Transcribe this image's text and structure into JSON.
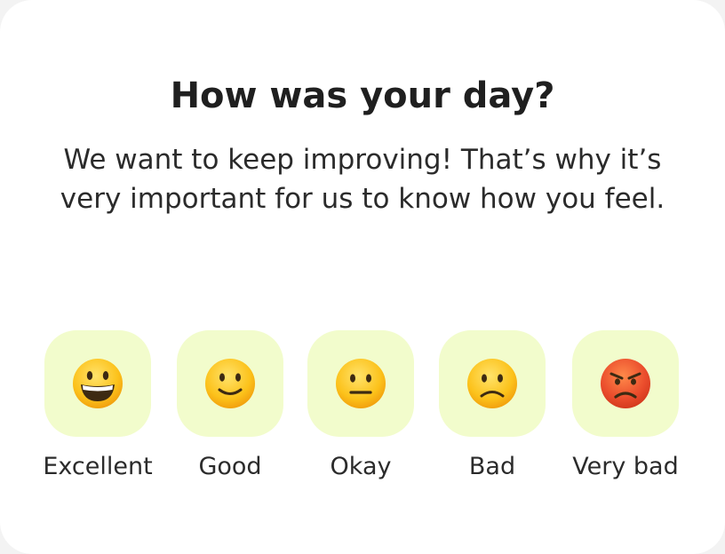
{
  "header": {
    "title": "How was your day?",
    "subtitle": "We want to keep improving! That’s why it’s very important for us to know how you feel."
  },
  "ratings": [
    {
      "label": "Excellent",
      "icon": "grinning-face-icon"
    },
    {
      "label": "Good",
      "icon": "slightly-smiling-face-icon"
    },
    {
      "label": "Okay",
      "icon": "neutral-face-icon"
    },
    {
      "label": "Bad",
      "icon": "slightly-frowning-face-icon"
    },
    {
      "label": "Very bad",
      "icon": "angry-face-icon"
    }
  ],
  "colors": {
    "tile_background": "#f2fccc",
    "text": "#1f1f1f",
    "emoji_yellow": "#fcc21b",
    "emoji_red": "#ea4c2c"
  }
}
